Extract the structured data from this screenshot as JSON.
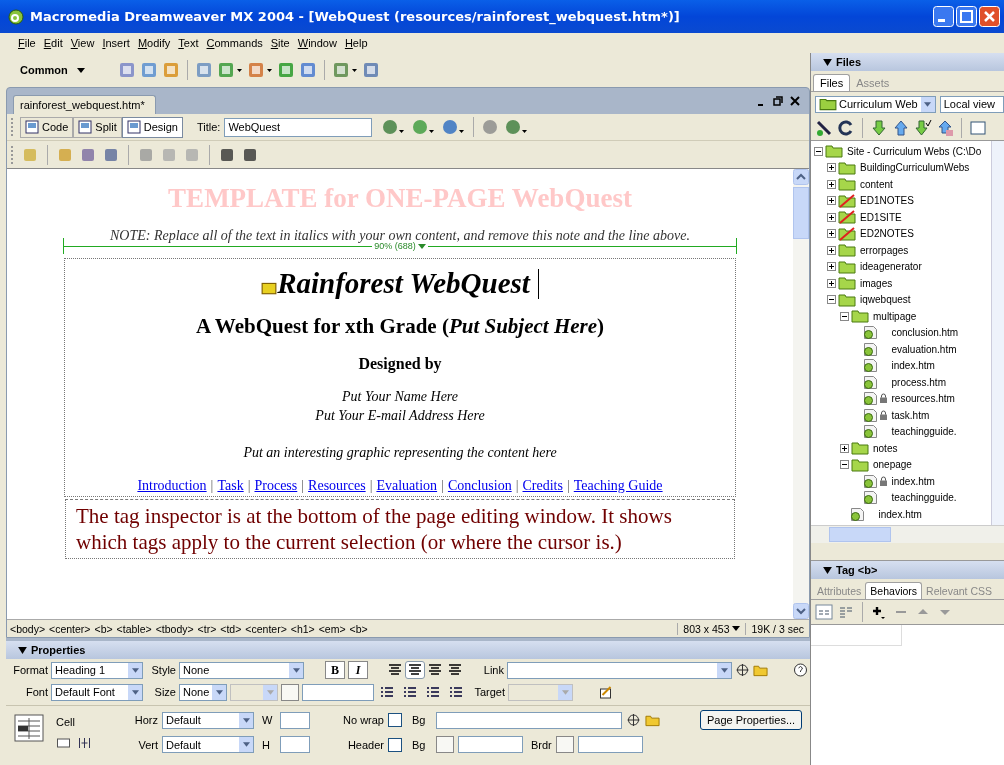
{
  "window": {
    "title": "Macromedia Dreamweaver MX 2004 - [WebQuest (resources/rainforest_webquest.htm*)]"
  },
  "menu": [
    "File",
    "Edit",
    "View",
    "Insert",
    "Modify",
    "Text",
    "Commands",
    "Site",
    "Window",
    "Help"
  ],
  "insert_bar": {
    "category": "Common"
  },
  "document": {
    "tab": "rainforest_webquest.htm*",
    "views": [
      {
        "label": "Code",
        "selected": false
      },
      {
        "label": "Split",
        "selected": false
      },
      {
        "label": "Design",
        "selected": true
      }
    ],
    "title_label": "Title:",
    "title_value": "WebQuest",
    "page": {
      "template_heading": "TEMPLATE for ONE-PAGE WebQuest",
      "note": "NOTE: Replace all of the text in italics with your own content, and remove this note and the line above.",
      "table_width": "90% (688)",
      "heading": "Rainforest WebQuest",
      "subheading": "A WebQuest for xth Grade (*Put Subject Here*)",
      "designed_by": "Designed by",
      "name": "Put Your Name Here",
      "email": "Put Your E-mail Address Here",
      "graphic": "Put an interesting graphic representing the content here",
      "nav": [
        {
          "kind": "link",
          "text": "Introduction"
        },
        {
          "kind": "separator",
          "text": "|"
        },
        {
          "kind": "link",
          "text": "Task"
        },
        {
          "kind": "separator",
          "text": "|"
        },
        {
          "kind": "link",
          "text": "Process"
        },
        {
          "kind": "separator",
          "text": "|"
        },
        {
          "kind": "link",
          "text": "Resources"
        },
        {
          "kind": "separator",
          "text": "|"
        },
        {
          "kind": "link",
          "text": "Evaluation"
        },
        {
          "kind": "separator",
          "text": "|"
        },
        {
          "kind": "link",
          "text": "Conclusion"
        },
        {
          "kind": "separator",
          "text": "|"
        },
        {
          "kind": "link",
          "text": "Credits"
        },
        {
          "kind": "separator",
          "text": "|"
        },
        {
          "kind": "link",
          "text": "Teaching Guide"
        }
      ],
      "tip": "The tag inspector is at the bottom of the page editing window. It shows which tags apply to the current selection (or where the cursor is.)"
    },
    "tag_selector": [
      "<body>",
      "<center>",
      "<b>",
      "<table>",
      "<tbody>",
      "<tr>",
      "<td>",
      "<center>",
      "<h1>",
      "<em>",
      "<b>"
    ],
    "window_size": "803 x 453",
    "download": "19K / 3 sec"
  },
  "properties": {
    "title": "Properties",
    "format_label": "Format",
    "format": "Heading 1",
    "style_label": "Style",
    "style": "None",
    "font_label": "Font",
    "font": "Default Font",
    "size_label": "Size",
    "size": "None",
    "bold": "B",
    "italic": "I",
    "align": [
      {
        "selected": false
      },
      {
        "selected": true
      },
      {
        "selected": false
      },
      {
        "selected": false
      }
    ],
    "link_label": "Link",
    "target_label": "Target",
    "cell_label": "Cell",
    "horz_label": "Horz",
    "horz": "Default",
    "vert_label": "Vert",
    "vert": "Default",
    "w_label": "W",
    "h_label": "H",
    "nowrap_label": "No wrap",
    "nowrap": false,
    "header_label": "Header",
    "header": false,
    "bg_label": "Bg",
    "bg2_label": "Bg",
    "brdr_label": "Brdr",
    "page_properties": "Page Properties..."
  },
  "files": {
    "title": "Files",
    "tabs": [
      {
        "label": "Files",
        "selected": true
      },
      {
        "label": "Assets",
        "selected": false
      }
    ],
    "site": "Curriculum Web",
    "view": "Local view",
    "tree": [
      {
        "name": "Site - Curriculum Webs (C:\\Do",
        "kind": "site",
        "expanded": true,
        "children": [
          {
            "name": "BuildingCurriculumWebs",
            "kind": "folder",
            "expanded": false,
            "cloaked": false
          },
          {
            "name": "content",
            "kind": "folder",
            "expanded": false,
            "cloaked": false
          },
          {
            "name": "ED1NOTES",
            "kind": "folder",
            "expanded": false,
            "cloaked": true
          },
          {
            "name": "ED1SITE",
            "kind": "folder",
            "expanded": false,
            "cloaked": true
          },
          {
            "name": "ED2NOTES",
            "kind": "folder",
            "expanded": false,
            "cloaked": true
          },
          {
            "name": "errorpages",
            "kind": "folder",
            "expanded": false,
            "cloaked": false
          },
          {
            "name": "ideagenerator",
            "kind": "folder",
            "expanded": false,
            "cloaked": false
          },
          {
            "name": "images",
            "kind": "folder",
            "expanded": false,
            "cloaked": false
          },
          {
            "name": "iqwebquest",
            "kind": "folder",
            "expanded": true,
            "cloaked": false,
            "children": [
              {
                "name": "multipage",
                "kind": "folder",
                "expanded": true,
                "cloaked": false,
                "children": [
                  {
                    "name": "conclusion.htm",
                    "kind": "file",
                    "locked": false
                  },
                  {
                    "name": "evaluation.htm",
                    "kind": "file",
                    "locked": false
                  },
                  {
                    "name": "index.htm",
                    "kind": "file",
                    "locked": false
                  },
                  {
                    "name": "process.htm",
                    "kind": "file",
                    "locked": false
                  },
                  {
                    "name": "resources.htm",
                    "kind": "file",
                    "locked": true
                  },
                  {
                    "name": "task.htm",
                    "kind": "file",
                    "locked": true
                  },
                  {
                    "name": "teachingguide.",
                    "kind": "file",
                    "locked": false
                  }
                ]
              },
              {
                "name": "notes",
                "kind": "folder",
                "expanded": false,
                "cloaked": false
              },
              {
                "name": "onepage",
                "kind": "folder",
                "expanded": true,
                "cloaked": false,
                "children": [
                  {
                    "name": "index.htm",
                    "kind": "file",
                    "locked": true
                  },
                  {
                    "name": "teachingguide.",
                    "kind": "file",
                    "locked": false
                  }
                ]
              },
              {
                "name": "index.htm",
                "kind": "file",
                "locked": false
              }
            ]
          }
        ]
      }
    ]
  },
  "tag_panel": {
    "title": "Tag <b>",
    "tabs": [
      {
        "label": "Attributes",
        "selected": false
      },
      {
        "label": "Behaviors",
        "selected": true
      },
      {
        "label": "Relevant CSS",
        "selected": false
      }
    ]
  }
}
